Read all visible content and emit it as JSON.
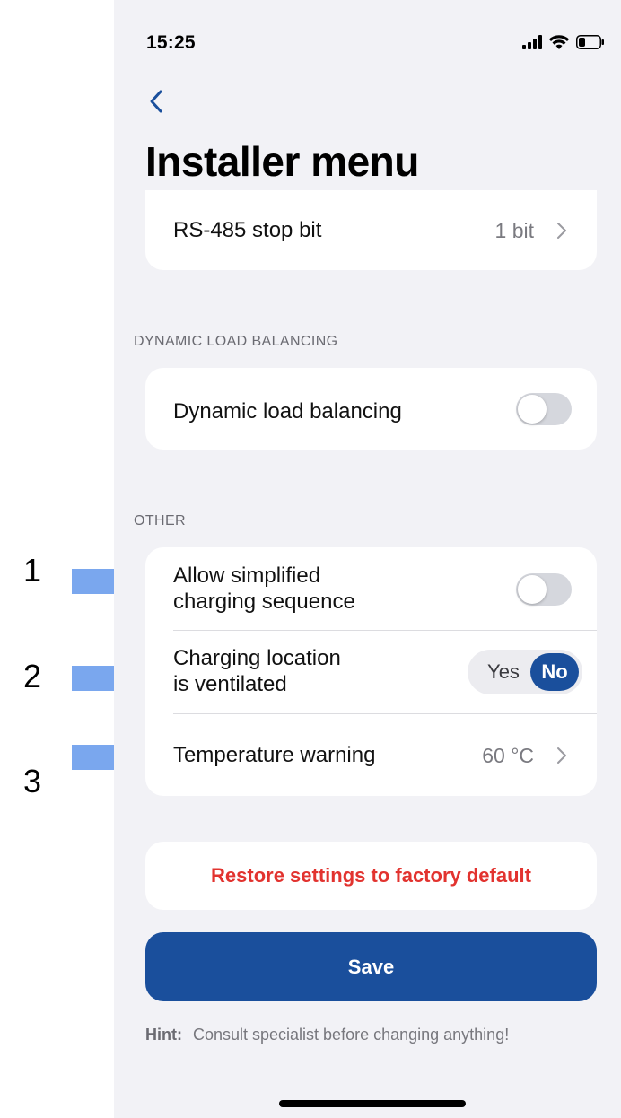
{
  "status_bar": {
    "time": "15:25"
  },
  "header": {
    "title": "Installer menu"
  },
  "rs485": {
    "label": "RS-485 stop bit",
    "value": "1 bit"
  },
  "dlb": {
    "section": "DYNAMIC LOAD BALANCING",
    "label": "Dynamic load balancing",
    "enabled": false
  },
  "other": {
    "section": "OTHER",
    "simplified": {
      "label_line1": "Allow simplified",
      "label_line2": "charging sequence",
      "enabled": false
    },
    "ventilated": {
      "label_line1": "Charging location",
      "label_line2": "is ventilated",
      "yes": "Yes",
      "no": "No",
      "selected": "No"
    },
    "temperature": {
      "label": "Temperature warning",
      "value": "60 °C"
    }
  },
  "actions": {
    "restore": "Restore settings to factory default",
    "save": "Save"
  },
  "hint": {
    "prefix": "Hint:",
    "text": "Consult specialist before changing anything!"
  },
  "annotations": {
    "one": "1",
    "two": "2",
    "three": "3"
  },
  "colors": {
    "accent": "#1a4f9c",
    "danger": "#e2332f",
    "arrow": "#7aa7ee",
    "background": "#f2f2f6"
  }
}
